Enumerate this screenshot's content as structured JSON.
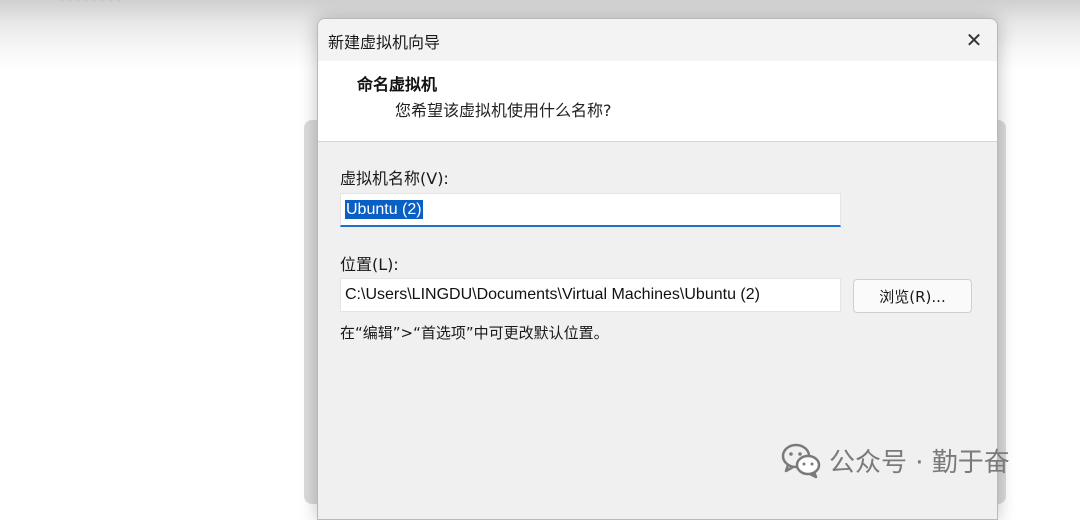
{
  "background": {
    "ghost_text": "········"
  },
  "dialog": {
    "title": "新建虚拟机向导",
    "close_symbol": "✕",
    "header": {
      "title": "命名虚拟机",
      "subtitle": "您希望该虚拟机使用什么名称?"
    },
    "name_field": {
      "label": "虚拟机名称(V):",
      "value": "Ubuntu (2)"
    },
    "location_field": {
      "label": "位置(L):",
      "value": "C:\\Users\\LINGDU\\Documents\\Virtual Machines\\Ubuntu (2)"
    },
    "browse_button": "浏览(R)...",
    "hint": "在“编辑”>“首选项”中可更改默认位置。"
  },
  "watermark": {
    "text": "公众号 · 勤于奋",
    "icon": "wechat-icon"
  },
  "colors": {
    "accent": "#1f6fc6",
    "selection": "#0a5fc4"
  }
}
